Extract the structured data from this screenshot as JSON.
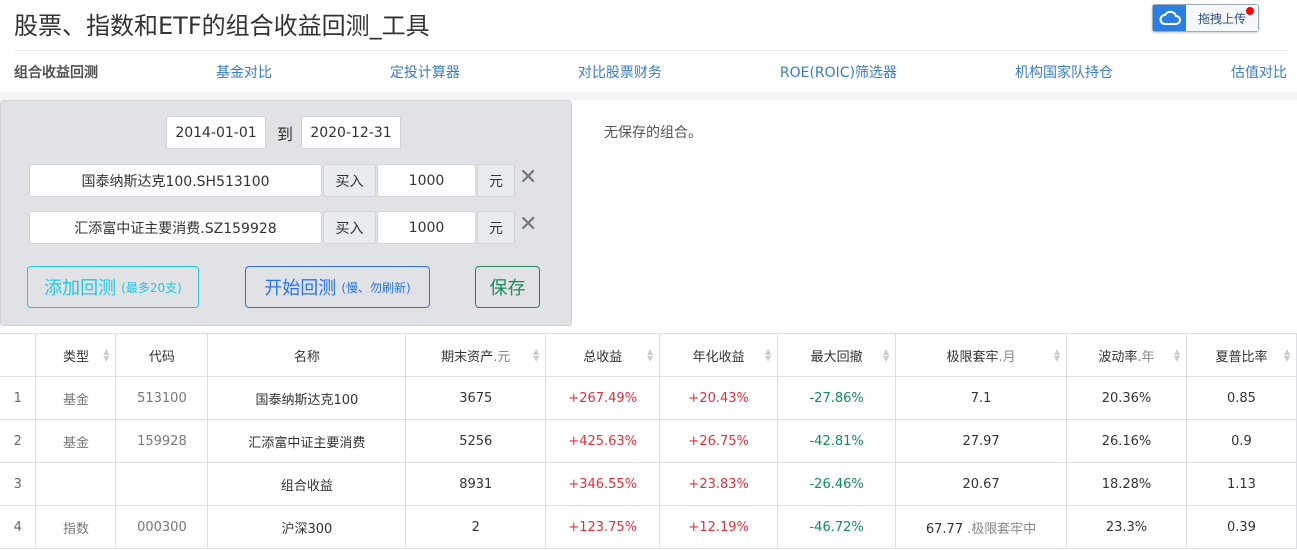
{
  "title": "股票、指数和ETF的组合收益回测_工具",
  "upload_label": "拖拽上传",
  "nav": [
    "组合收益回测",
    "基金对比",
    "定投计算器",
    "对比股票财务",
    "ROE(ROIC)筛选器",
    "机构国家队持仓",
    "估值对比"
  ],
  "form": {
    "start_date": "2014-01-01",
    "to_label": "到",
    "end_date": "2020-12-31",
    "rows": [
      {
        "name": "国泰纳斯达克100.SH513100",
        "action": "买入",
        "amount": "1000",
        "unit": "元"
      },
      {
        "name": "汇添富中证主要消费.SZ159928",
        "action": "买入",
        "amount": "1000",
        "unit": "元"
      }
    ],
    "add_label": "添加回测",
    "add_note": "(最多20支)",
    "start_label": "开始回测",
    "start_note": "(慢、勿刷新)",
    "save_label": "保存"
  },
  "saved_text": "无保存的组合。",
  "table": {
    "headers": [
      {
        "label": "",
        "sort": false
      },
      {
        "label": "类型",
        "sort": true
      },
      {
        "label": "代码",
        "sort": false
      },
      {
        "label": "名称",
        "sort": false
      },
      {
        "label": "期末资产",
        "unit": ".元",
        "sort": true
      },
      {
        "label": "总收益",
        "sort": true
      },
      {
        "label": "年化收益",
        "sort": true
      },
      {
        "label": "最大回撤",
        "sort": true
      },
      {
        "label": "极限套牢",
        "unit": ".月",
        "sort": true
      },
      {
        "label": "波动率",
        "unit": ".年",
        "sort": true
      },
      {
        "label": "夏普比率",
        "sort": true
      }
    ],
    "rows": [
      [
        "1",
        "基金",
        "513100",
        "国泰纳斯达克100",
        "3675",
        "+267.49%",
        "+20.43%",
        "-27.86%",
        "7.1",
        "20.36%",
        "0.85",
        ""
      ],
      [
        "2",
        "基金",
        "159928",
        "汇添富中证主要消费",
        "5256",
        "+425.63%",
        "+26.75%",
        "-42.81%",
        "27.97",
        "26.16%",
        "0.9",
        ""
      ],
      [
        "3",
        "",
        "",
        "组合收益",
        "8931",
        "+346.55%",
        "+23.83%",
        "-26.46%",
        "20.67",
        "18.28%",
        "1.13",
        ""
      ],
      [
        "4",
        "指数",
        "000300",
        "沪深300",
        "2",
        "+123.75%",
        "+12.19%",
        "-46.72%",
        "67.77",
        "23.3%",
        "0.39",
        ".极限套牢中"
      ]
    ]
  },
  "colors": {
    "up": "#e0303a",
    "down": "#128a5a",
    "link": "#3b7cc0"
  }
}
